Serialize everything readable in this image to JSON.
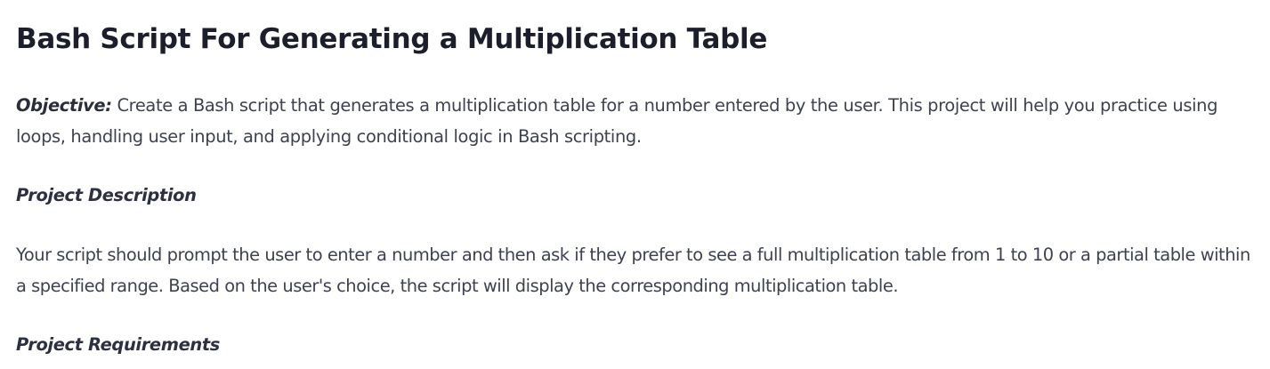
{
  "page": {
    "title": "Bash Script For Generating a Multiplication Table",
    "objective": {
      "label": "Objective:",
      "text": "Create a Bash script that generates a multiplication table for a number entered by the user. This project will help you practice using loops, handling user input, and applying conditional logic in Bash scripting."
    },
    "sections": {
      "description_heading": "Project Description",
      "description_text": "Your script should prompt the user to enter a number and then ask if they prefer to see a full multiplication table from 1 to 10 or a partial table within a specified range. Based on the user's choice, the script will display the corresponding multiplication table.",
      "requirements_heading": "Project Requirements"
    }
  }
}
